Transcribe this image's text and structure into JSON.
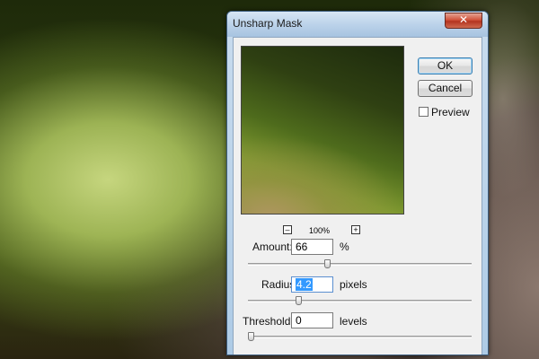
{
  "dialog": {
    "title": "Unsharp Mask",
    "close_glyph": "✕",
    "buttons": {
      "ok": "OK",
      "cancel": "Cancel"
    },
    "preview": {
      "label": "Preview",
      "checked": false
    },
    "zoom": {
      "minus": "–",
      "level": "100%",
      "plus": "+"
    },
    "fields": {
      "amount": {
        "label": "Amount:",
        "value": "66",
        "unit": "%",
        "slider_fraction": 0.35
      },
      "radius": {
        "label": "Radius:",
        "value": "4.2",
        "unit": "pixels",
        "slider_fraction": 0.22
      },
      "threshold": {
        "label": "Threshold:",
        "value": "0",
        "unit": "levels",
        "slider_fraction": 0.0
      }
    }
  },
  "icons": {
    "close": "close-icon",
    "zoom_out": "zoom-out-icon",
    "zoom_in": "zoom-in-icon"
  }
}
